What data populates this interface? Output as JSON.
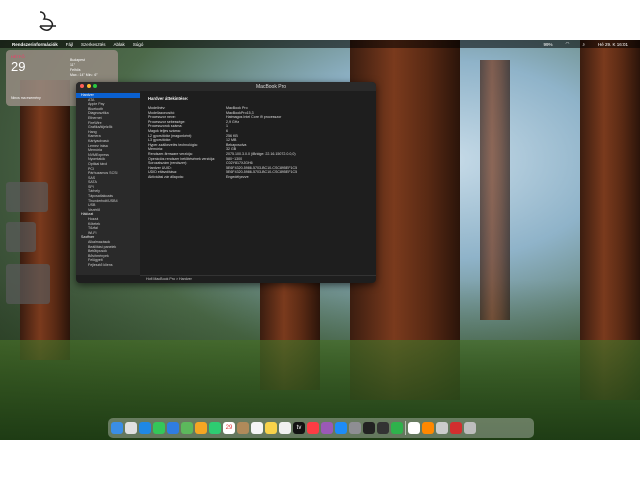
{
  "menubar": {
    "apple": "",
    "app_name": "Rendszerinformációk",
    "menus": [
      "Fájl",
      "Szerkesztés",
      "Ablak",
      "Súgó"
    ],
    "clock": "Hé 29. K 16:01",
    "battery": "99%"
  },
  "widget": {
    "dow": "HÉTFŐ",
    "day": "29",
    "no_events": "Nincs ma esemény",
    "weather_lines": [
      "Budapest",
      "11°",
      "Felhős",
      "Max.: 14° Min.: 6°"
    ]
  },
  "window": {
    "title": "MacBook Pro",
    "sidebar": [
      {
        "label": "Hardver",
        "head": true,
        "selected": true
      },
      {
        "label": "ATA"
      },
      {
        "label": "Apple Pay"
      },
      {
        "label": "Bluetooth"
      },
      {
        "label": "Diagnosztika"
      },
      {
        "label": "Ethernet"
      },
      {
        "label": "FireWire"
      },
      {
        "label": "Grafika/kijelzők"
      },
      {
        "label": "Hang"
      },
      {
        "label": "Kamera"
      },
      {
        "label": "Kártyaolvasó"
      },
      {
        "label": "Lemez írása"
      },
      {
        "label": "Memória"
      },
      {
        "label": "NVMExpress"
      },
      {
        "label": "Nyomtatók"
      },
      {
        "label": "Optikai tárol"
      },
      {
        "label": "PCI"
      },
      {
        "label": "Párhuzamos SCSI"
      },
      {
        "label": "SAS"
      },
      {
        "label": "SATA"
      },
      {
        "label": "SPI"
      },
      {
        "label": "Tárhely"
      },
      {
        "label": "Tápcsatlakozás"
      },
      {
        "label": "Thunderbolt/USB4"
      },
      {
        "label": "USB"
      },
      {
        "label": "Vezérlő"
      },
      {
        "label": "Hálózat",
        "head": true
      },
      {
        "label": "Hozzá"
      },
      {
        "label": "Kötetek"
      },
      {
        "label": "Tűzfal"
      },
      {
        "label": "Wi-Fi"
      },
      {
        "label": "Szoftver",
        "head": true
      },
      {
        "label": "Alkalmazások"
      },
      {
        "label": "Beállítási panelek"
      },
      {
        "label": "Betűtípusok"
      },
      {
        "label": "Bővítmények"
      },
      {
        "label": "Felügyelt"
      },
      {
        "label": "Fejlesztő kliens"
      }
    ],
    "content_title": "Hardver áttekintése:",
    "rows": [
      {
        "k": "Modellnév:",
        "v": "MacBook Pro"
      },
      {
        "k": "Modellazonosító:",
        "v": "MacBookPro15,3"
      },
      {
        "k": "Processzor neve:",
        "v": "Hatmagos Intel Core i9 processzor"
      },
      {
        "k": "Processzor sebessége:",
        "v": "2,9 GHz"
      },
      {
        "k": "Processzorok száma:",
        "v": "1"
      },
      {
        "k": "Magok teljes száma:",
        "v": "6"
      },
      {
        "k": "L2 gyorsítótár (magonként):",
        "v": "256 KB"
      },
      {
        "k": "L3 gyorsítótár:",
        "v": "12 MB"
      },
      {
        "k": "Hyper-szálkezelés technológia:",
        "v": "Bekapcsolva"
      },
      {
        "k": "Memória:",
        "v": "32 GB"
      },
      {
        "k": "Rendszer-firmware verziója:",
        "v": "2075.100.3.0.0 (iBridge: 22.16.15072.0.0,0)"
      },
      {
        "k": "Operációs rendszer betöltésének verziója:",
        "v": "580~1300"
      },
      {
        "k": "Sorozatszám (rendszer):",
        "v": "C02Y817XJGH6"
      },
      {
        "k": "Hardver UUID:",
        "v": "5E6F4320-5986-5703-BC10-CSC895EF1C5"
      },
      {
        "k": "UDID eltávolítása:",
        "v": "5E6F4320-5986-5703-BC10-CSC895EF1C5"
      },
      {
        "k": "Aktiválási zár állapota:",
        "v": "Engedélyezve"
      }
    ],
    "path": "Hofi MacBook Pro > Hardver"
  },
  "dock": {
    "apps": [
      {
        "name": "finder-icon",
        "color": "#3a8ee6"
      },
      {
        "name": "launchpad-icon",
        "color": "#e0e0e0"
      },
      {
        "name": "safari-icon",
        "color": "#1e88e5"
      },
      {
        "name": "messages-icon",
        "color": "#34c759"
      },
      {
        "name": "mail-icon",
        "color": "#2f7de1"
      },
      {
        "name": "maps-icon",
        "color": "#5cb85c"
      },
      {
        "name": "photos-icon",
        "color": "#f5a623"
      },
      {
        "name": "facetime-icon",
        "color": "#2ecc71"
      },
      {
        "name": "calendar-icon",
        "color": "#ffffff",
        "text": "29"
      },
      {
        "name": "contacts-icon",
        "color": "#b08a5a"
      },
      {
        "name": "reminders-icon",
        "color": "#f5f5f5"
      },
      {
        "name": "notes-icon",
        "color": "#f8d34a"
      },
      {
        "name": "freeform-icon",
        "color": "#f0f0f0"
      },
      {
        "name": "tv-icon",
        "color": "#111111",
        "text": "tv"
      },
      {
        "name": "music-icon",
        "color": "#fc3c44"
      },
      {
        "name": "podcasts-icon",
        "color": "#9b59b6"
      },
      {
        "name": "app-store-icon",
        "color": "#1d8cf8"
      },
      {
        "name": "system-settings-icon",
        "color": "#8e8e93"
      },
      {
        "name": "terminal-icon",
        "color": "#222222"
      },
      {
        "name": "activity-icon",
        "color": "#333333"
      },
      {
        "name": "numbers-icon",
        "color": "#2fb24c"
      },
      {
        "name": "chrome-icon",
        "color": "#ffffff"
      },
      {
        "name": "vlc-icon",
        "color": "#ff8800"
      },
      {
        "name": "preview-icon",
        "color": "#cccccc"
      },
      {
        "name": "acrobat-icon",
        "color": "#d32f2f"
      },
      {
        "name": "trash-icon",
        "color": "#bdbdbd"
      }
    ]
  }
}
